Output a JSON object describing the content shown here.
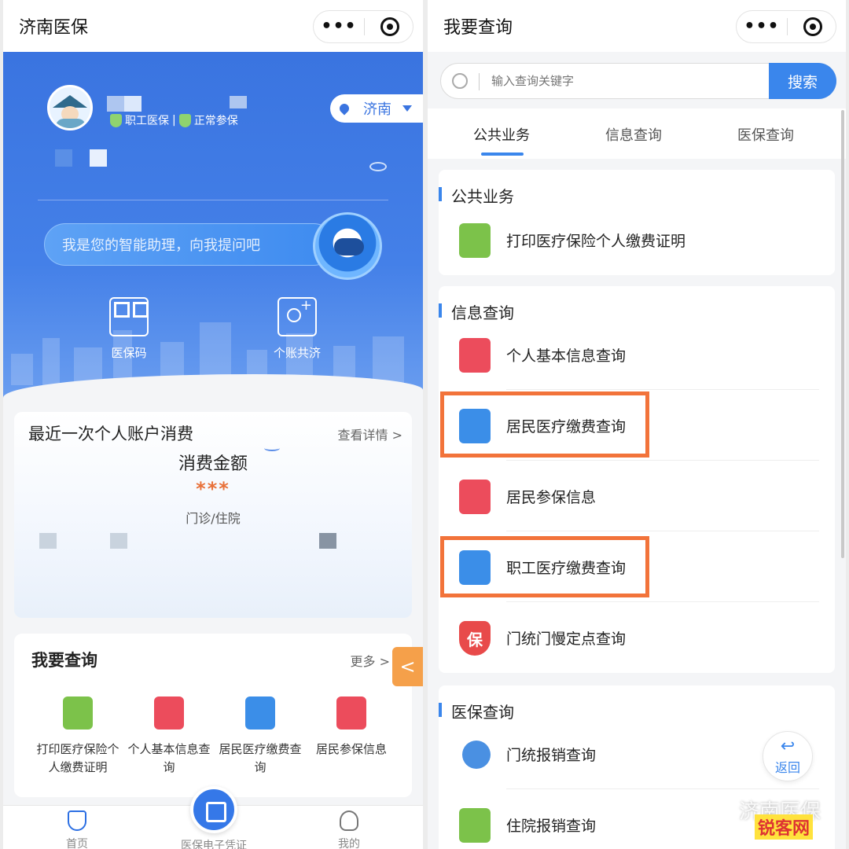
{
  "left": {
    "window_title": "济南医保",
    "capsule": {
      "more": "•••"
    },
    "profile": {
      "badge_employee": "职工医保",
      "badge_separator": "|",
      "badge_status": "正常参保",
      "city": "济南"
    },
    "assistant": {
      "placeholder": "我是您的智能助理，向我提问吧"
    },
    "features": [
      {
        "label": "医保码",
        "icon": "qr-grid-icon"
      },
      {
        "label": "个账共济",
        "icon": "family-share-icon"
      }
    ],
    "last_spend": {
      "title": "最近一次个人账户消费",
      "details": "查看详情 >",
      "amount_label": "消费金额",
      "amount": "***",
      "type": "门诊/住院"
    },
    "query": {
      "title": "我要查询",
      "more": "更多 >",
      "items": [
        {
          "label": "打印医疗保险个人缴费证明",
          "icon": "printer-icon"
        },
        {
          "label": "个人基本信息查询",
          "icon": "contact-book-icon"
        },
        {
          "label": "居民医疗缴费查询",
          "icon": "document-search-icon"
        },
        {
          "label": "居民参保信息",
          "icon": "contact-book-icon"
        }
      ]
    },
    "side_tab": "<",
    "nav": [
      {
        "label": "首页",
        "icon": "shield-plus-icon"
      },
      {
        "label": "医保电子凭证",
        "icon": "qr-icon"
      },
      {
        "label": "我的",
        "icon": "person-icon"
      }
    ]
  },
  "right": {
    "window_title": "我要查询",
    "capsule": {
      "more": "•••"
    },
    "search": {
      "placeholder": "输入查询关键字",
      "button": "搜索"
    },
    "tabs": [
      {
        "label": "公共业务",
        "active": true
      },
      {
        "label": "信息查询",
        "active": false
      },
      {
        "label": "医保查询",
        "active": false
      }
    ],
    "sections": [
      {
        "title": "公共业务",
        "items": [
          {
            "label": "打印医疗保险个人缴费证明",
            "icon": "printer-icon"
          }
        ]
      },
      {
        "title": "信息查询",
        "items": [
          {
            "label": "个人基本信息查询",
            "icon": "contact-book-icon",
            "highlighted": false
          },
          {
            "label": "居民医疗缴费查询",
            "icon": "document-search-icon",
            "highlighted": true
          },
          {
            "label": "居民参保信息",
            "icon": "contact-book-icon",
            "highlighted": false
          },
          {
            "label": "职工医疗缴费查询",
            "icon": "document-search-icon",
            "highlighted": true
          },
          {
            "label": "门统门慢定点查询",
            "icon": "shield-bao-icon",
            "shield_text": "保",
            "highlighted": false
          }
        ]
      },
      {
        "title": "医保查询",
        "items": [
          {
            "label": "门统报销查询",
            "icon": "yuan-cross-icon"
          },
          {
            "label": "住院报销查询",
            "icon": "hospital-yuan-icon"
          }
        ]
      }
    ],
    "back_button": "返回",
    "watermark": "济南医保",
    "watermark_site": "锐客网"
  },
  "colors": {
    "primary": "#3a74e0",
    "highlight": "#f2733a",
    "amount": "#e8713a"
  }
}
